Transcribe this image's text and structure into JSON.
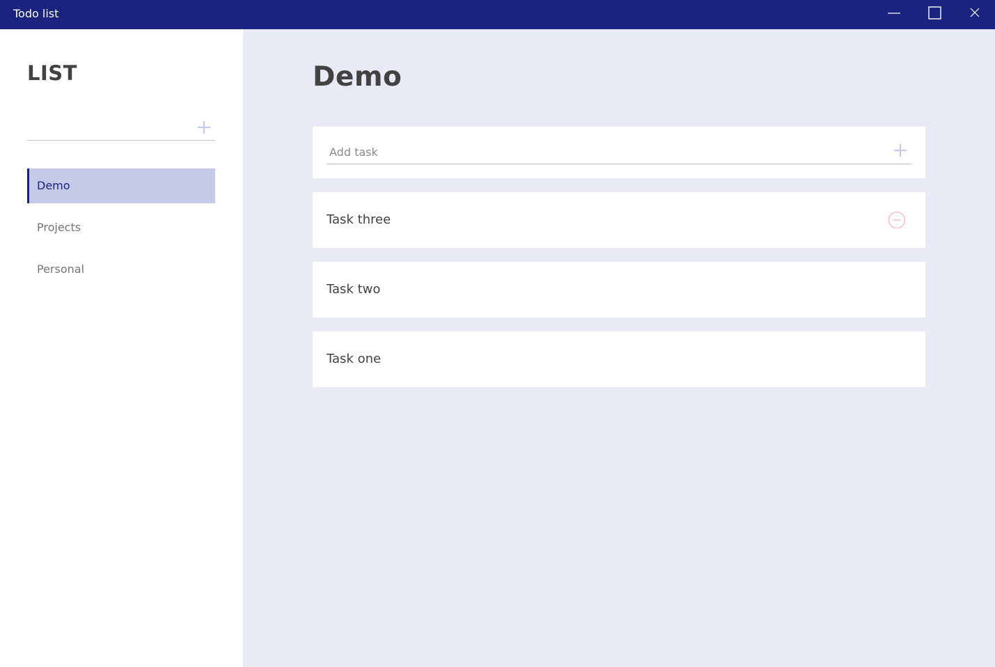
{
  "window": {
    "title": "Todo list",
    "controls": {
      "minimize_icon": "minimize-icon",
      "maximize_icon": "maximize-icon",
      "close_icon": "close-icon"
    }
  },
  "sidebar": {
    "heading": "LIST",
    "new_list": {
      "value": "",
      "placeholder": "",
      "add_icon": "plus-icon"
    },
    "items": [
      {
        "label": "Demo",
        "active": true
      },
      {
        "label": "Projects",
        "active": false
      },
      {
        "label": "Personal",
        "active": false
      }
    ]
  },
  "main": {
    "title": "Demo",
    "add_task": {
      "value": "",
      "placeholder": "Add task",
      "add_icon": "plus-icon"
    },
    "tasks": [
      {
        "label": "Task three",
        "remove_icon": "minus-circle-icon"
      },
      {
        "label": "Task two"
      },
      {
        "label": "Task one"
      }
    ]
  },
  "colors": {
    "titlebar": "#1a237e",
    "sidebar_active_bg": "#c5cae9",
    "sidebar_active_accent": "#1a237e",
    "main_bg": "#e8eaf6",
    "plus_icon": "#c5cae9",
    "remove_icon": "#f8bbd0"
  }
}
